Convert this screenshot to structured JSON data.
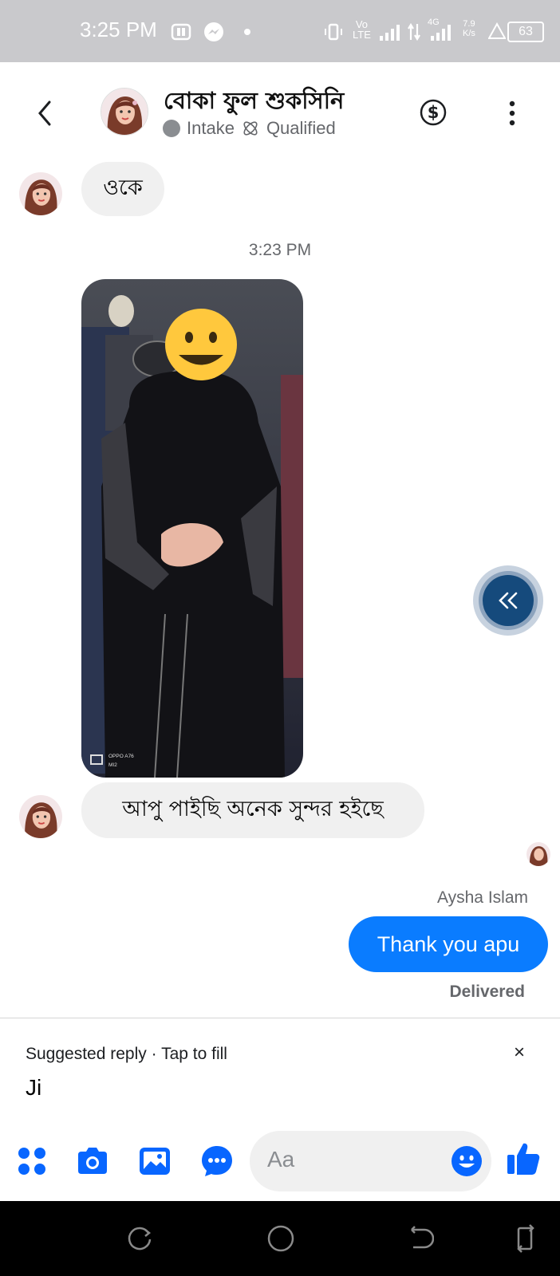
{
  "status_bar": {
    "time": "3:25 PM",
    "net_speed": "7.9",
    "net_unit": "K/s",
    "battery": "63",
    "volte": "Vo",
    "lte": "LTE",
    "fourg": "4G"
  },
  "header": {
    "contact_name": "বোকা ফুল শুকসিনি",
    "label_1": "Intake",
    "label_2": "Qualified"
  },
  "messages": {
    "incoming_1": "ওকে",
    "timestamp": "3:23 PM",
    "photo_watermark_1": "OPPO A76",
    "photo_watermark_2": "MI2",
    "incoming_2": "আপু পাইছি অনেক সুন্দর হইছে",
    "sender_name": "Aysha Islam",
    "outgoing_1": "Thank you apu",
    "delivery_status": "Delivered"
  },
  "suggested": {
    "heading": "Suggested reply",
    "separator": "·",
    "hint": "Tap to fill",
    "close": "×",
    "reply": "Ji"
  },
  "composer": {
    "placeholder": "Aa"
  },
  "colors": {
    "accent": "#0a7cff",
    "icon_blue": "#0866ff",
    "status_bar": "#c9c9cc"
  }
}
